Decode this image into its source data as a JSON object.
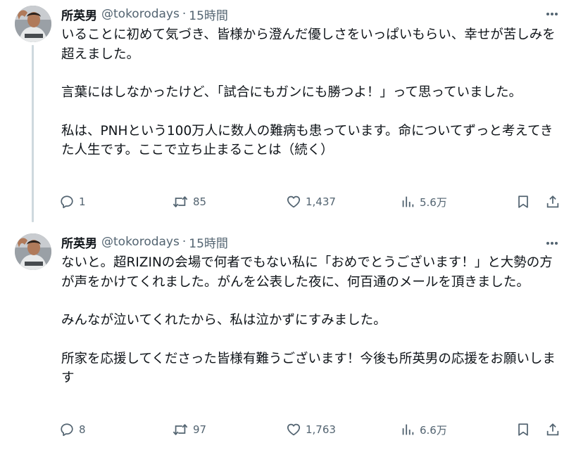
{
  "tweets": [
    {
      "author": "所英男",
      "handle": "@tokorodays",
      "separator": "·",
      "time": "15時間",
      "paragraphs": [
        "いることに初めて気づき、皆様から澄んだ優しさをいっぱいもらい、幸せが苦しみを超えました。",
        "言葉にはしなかったけど、「試合にもガンにも勝つよ！」って思っていました。",
        "私は、PNHという100万人に数人の難病も患っています。命についてずっと考えてきた人生です。ここで立ち止まることは（続く）"
      ],
      "stats": {
        "replies": "1",
        "retweets": "85",
        "likes": "1,437",
        "views": "5.6万"
      }
    },
    {
      "author": "所英男",
      "handle": "@tokorodays",
      "separator": "·",
      "time": "15時間",
      "paragraphs": [
        "ないと。超RIZINの会場で何者でもない私に「おめでとうございます！」と大勢の方が声をかけてくれました。がんを公表した夜に、何百通のメールを頂きました。",
        "みんなが泣いてくれたから、私は泣かずにすみました。",
        "所家を応援してくださった皆様有難うございます！今後も所英男の応援をお願いします"
      ],
      "stats": {
        "replies": "8",
        "retweets": "97",
        "likes": "1,763",
        "views": "6.6万"
      }
    }
  ],
  "icons": {
    "more": "more-dots-icon",
    "reply": "reply-icon",
    "retweet": "retweet-icon",
    "like": "heart-icon",
    "views": "views-chart-icon",
    "bookmark": "bookmark-icon",
    "share": "share-icon"
  },
  "colors": {
    "text": "#0f1419",
    "secondary": "#536471",
    "thread_line": "#cfd9de",
    "background": "#ffffff"
  }
}
